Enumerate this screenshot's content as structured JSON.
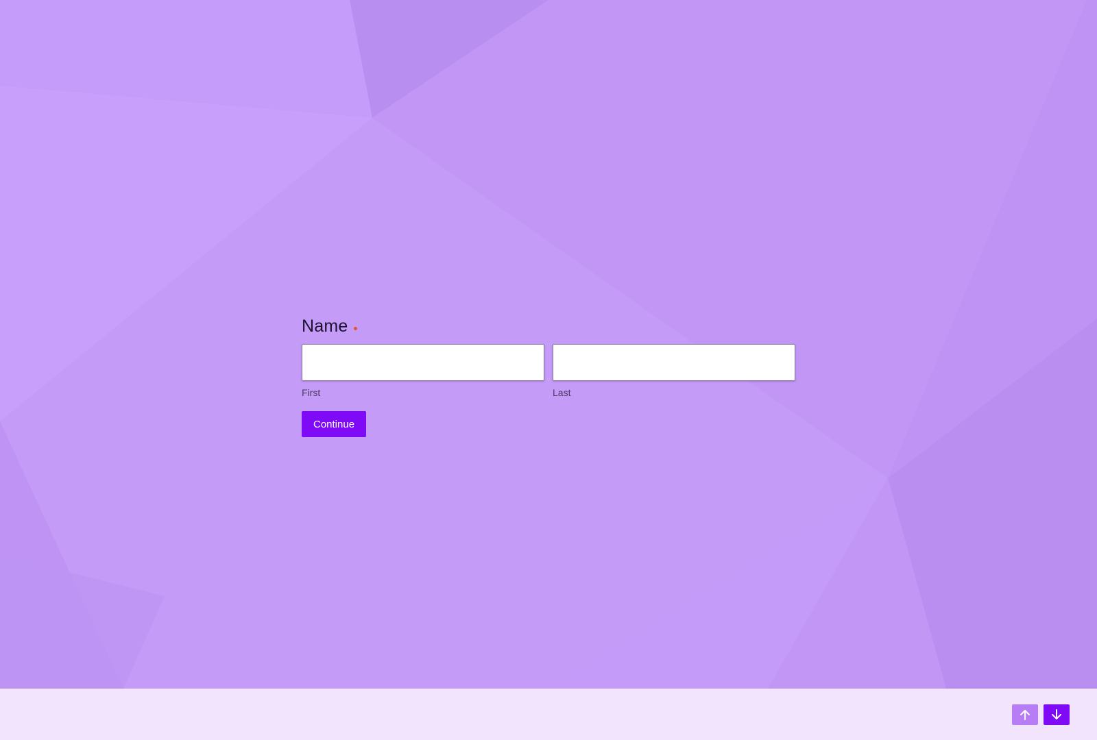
{
  "colors": {
    "background": "#c39af7",
    "accent": "#7f0af5",
    "accent_light": "#b77df5",
    "required": "#e0582a",
    "footer": "#f1e4fc"
  },
  "question": {
    "title": "Name",
    "required": true,
    "fields": [
      {
        "sublabel": "First",
        "value": "",
        "placeholder": ""
      },
      {
        "sublabel": "Last",
        "value": "",
        "placeholder": ""
      }
    ]
  },
  "actions": {
    "continue_label": "Continue"
  },
  "footer": {
    "up_icon": "arrow-up-icon",
    "down_icon": "arrow-down-icon"
  }
}
